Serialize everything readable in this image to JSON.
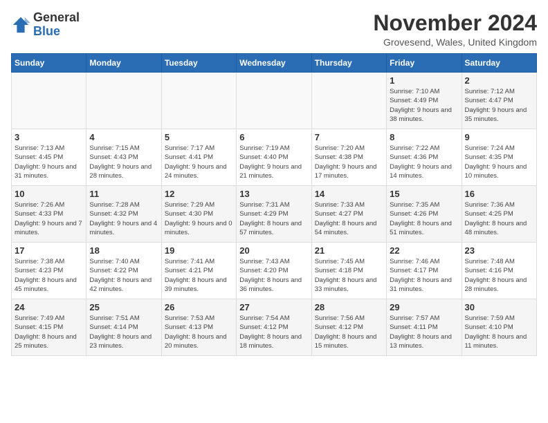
{
  "logo": {
    "general": "General",
    "blue": "Blue"
  },
  "header": {
    "month_year": "November 2024",
    "location": "Grovesend, Wales, United Kingdom"
  },
  "days_of_week": [
    "Sunday",
    "Monday",
    "Tuesday",
    "Wednesday",
    "Thursday",
    "Friday",
    "Saturday"
  ],
  "weeks": [
    [
      {
        "day": "",
        "info": ""
      },
      {
        "day": "",
        "info": ""
      },
      {
        "day": "",
        "info": ""
      },
      {
        "day": "",
        "info": ""
      },
      {
        "day": "",
        "info": ""
      },
      {
        "day": "1",
        "info": "Sunrise: 7:10 AM\nSunset: 4:49 PM\nDaylight: 9 hours\nand 38 minutes."
      },
      {
        "day": "2",
        "info": "Sunrise: 7:12 AM\nSunset: 4:47 PM\nDaylight: 9 hours\nand 35 minutes."
      }
    ],
    [
      {
        "day": "3",
        "info": "Sunrise: 7:13 AM\nSunset: 4:45 PM\nDaylight: 9 hours\nand 31 minutes."
      },
      {
        "day": "4",
        "info": "Sunrise: 7:15 AM\nSunset: 4:43 PM\nDaylight: 9 hours\nand 28 minutes."
      },
      {
        "day": "5",
        "info": "Sunrise: 7:17 AM\nSunset: 4:41 PM\nDaylight: 9 hours\nand 24 minutes."
      },
      {
        "day": "6",
        "info": "Sunrise: 7:19 AM\nSunset: 4:40 PM\nDaylight: 9 hours\nand 21 minutes."
      },
      {
        "day": "7",
        "info": "Sunrise: 7:20 AM\nSunset: 4:38 PM\nDaylight: 9 hours\nand 17 minutes."
      },
      {
        "day": "8",
        "info": "Sunrise: 7:22 AM\nSunset: 4:36 PM\nDaylight: 9 hours\nand 14 minutes."
      },
      {
        "day": "9",
        "info": "Sunrise: 7:24 AM\nSunset: 4:35 PM\nDaylight: 9 hours\nand 10 minutes."
      }
    ],
    [
      {
        "day": "10",
        "info": "Sunrise: 7:26 AM\nSunset: 4:33 PM\nDaylight: 9 hours\nand 7 minutes."
      },
      {
        "day": "11",
        "info": "Sunrise: 7:28 AM\nSunset: 4:32 PM\nDaylight: 9 hours\nand 4 minutes."
      },
      {
        "day": "12",
        "info": "Sunrise: 7:29 AM\nSunset: 4:30 PM\nDaylight: 9 hours\nand 0 minutes."
      },
      {
        "day": "13",
        "info": "Sunrise: 7:31 AM\nSunset: 4:29 PM\nDaylight: 8 hours\nand 57 minutes."
      },
      {
        "day": "14",
        "info": "Sunrise: 7:33 AM\nSunset: 4:27 PM\nDaylight: 8 hours\nand 54 minutes."
      },
      {
        "day": "15",
        "info": "Sunrise: 7:35 AM\nSunset: 4:26 PM\nDaylight: 8 hours\nand 51 minutes."
      },
      {
        "day": "16",
        "info": "Sunrise: 7:36 AM\nSunset: 4:25 PM\nDaylight: 8 hours\nand 48 minutes."
      }
    ],
    [
      {
        "day": "17",
        "info": "Sunrise: 7:38 AM\nSunset: 4:23 PM\nDaylight: 8 hours\nand 45 minutes."
      },
      {
        "day": "18",
        "info": "Sunrise: 7:40 AM\nSunset: 4:22 PM\nDaylight: 8 hours\nand 42 minutes."
      },
      {
        "day": "19",
        "info": "Sunrise: 7:41 AM\nSunset: 4:21 PM\nDaylight: 8 hours\nand 39 minutes."
      },
      {
        "day": "20",
        "info": "Sunrise: 7:43 AM\nSunset: 4:20 PM\nDaylight: 8 hours\nand 36 minutes."
      },
      {
        "day": "21",
        "info": "Sunrise: 7:45 AM\nSunset: 4:18 PM\nDaylight: 8 hours\nand 33 minutes."
      },
      {
        "day": "22",
        "info": "Sunrise: 7:46 AM\nSunset: 4:17 PM\nDaylight: 8 hours\nand 31 minutes."
      },
      {
        "day": "23",
        "info": "Sunrise: 7:48 AM\nSunset: 4:16 PM\nDaylight: 8 hours\nand 28 minutes."
      }
    ],
    [
      {
        "day": "24",
        "info": "Sunrise: 7:49 AM\nSunset: 4:15 PM\nDaylight: 8 hours\nand 25 minutes."
      },
      {
        "day": "25",
        "info": "Sunrise: 7:51 AM\nSunset: 4:14 PM\nDaylight: 8 hours\nand 23 minutes."
      },
      {
        "day": "26",
        "info": "Sunrise: 7:53 AM\nSunset: 4:13 PM\nDaylight: 8 hours\nand 20 minutes."
      },
      {
        "day": "27",
        "info": "Sunrise: 7:54 AM\nSunset: 4:12 PM\nDaylight: 8 hours\nand 18 minutes."
      },
      {
        "day": "28",
        "info": "Sunrise: 7:56 AM\nSunset: 4:12 PM\nDaylight: 8 hours\nand 15 minutes."
      },
      {
        "day": "29",
        "info": "Sunrise: 7:57 AM\nSunset: 4:11 PM\nDaylight: 8 hours\nand 13 minutes."
      },
      {
        "day": "30",
        "info": "Sunrise: 7:59 AM\nSunset: 4:10 PM\nDaylight: 8 hours\nand 11 minutes."
      }
    ]
  ]
}
